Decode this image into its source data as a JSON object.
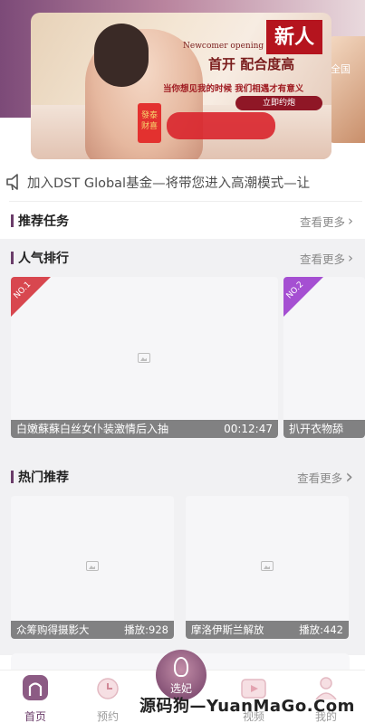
{
  "banner": {
    "newcomer": "Newcomer opening",
    "badge": "新人",
    "headline": "首开 配合度高",
    "subline": "当你想见我的时候 我们相遇才有意义",
    "cta": "立即约炮",
    "card_text": "發泰财喜",
    "side_text": "全国"
  },
  "notice": {
    "text": "加入DST Global基金—将带您进入高潮模式—让"
  },
  "sections": {
    "tasks": {
      "title": "推荐任务",
      "more": "查看更多"
    },
    "ranking": {
      "title": "人气排行",
      "more": "查看更多"
    },
    "hot": {
      "title": "热门推荐",
      "more": "查看更多"
    }
  },
  "ranking_items": [
    {
      "rank": "NO.1",
      "title": "白嫩蘇蘇白丝女仆装激情后入抽",
      "duration": "00:12:47",
      "ribbon_color": "#d8474f"
    },
    {
      "rank": "NO.2",
      "title": "扒开衣物舔",
      "ribbon_color": "#a54fd2"
    }
  ],
  "hot_items": [
    {
      "title": "众筹购得摄影大",
      "plays": "播放:928"
    },
    {
      "title": "摩洛伊斯兰解放",
      "plays": "播放:442"
    }
  ],
  "tabbar": {
    "home": "首页",
    "booking": "预约",
    "center": "选妃",
    "video": "视频",
    "mine": "我的"
  },
  "watermark": "源码狗—YuanMaGo.Com",
  "colors": {
    "accent": "#6b3d6a",
    "rank1": "#d8474f",
    "rank2": "#a54fd2"
  }
}
